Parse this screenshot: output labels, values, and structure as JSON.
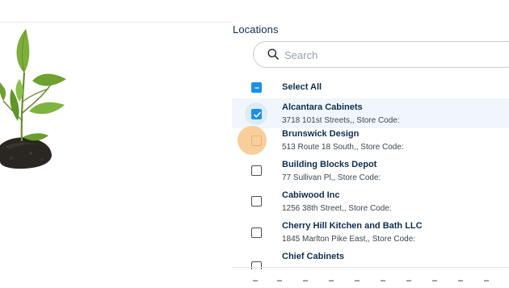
{
  "panel": {
    "title": "Locations"
  },
  "search": {
    "placeholder": "Search",
    "value": ""
  },
  "select_all": {
    "label": "Select All",
    "state": "partial"
  },
  "locations": [
    {
      "name": "Alcantara Cabinets",
      "address": "3718 101st Streets,, Store Code:",
      "checked": true
    },
    {
      "name": "Brunswick Design",
      "address": "513 Route 18 South,, Store Code:",
      "checked": false,
      "hovered": true
    },
    {
      "name": "Building Blocks Depot",
      "address": "77 Sullivan Pl,, Store Code:",
      "checked": false
    },
    {
      "name": "Cabiwood Inc",
      "address": "1256 38th Street,, Store Code:",
      "checked": false
    },
    {
      "name": "Cherry Hill Kitchen and Bath LLC",
      "address": "1845 Marlton Pike East,, Store Code:",
      "checked": false
    },
    {
      "name": "Chief Cabinets",
      "address": "",
      "checked": false
    }
  ],
  "colors": {
    "accent": "#1e8fe6",
    "hover_halo": "#f7c98f",
    "selected_row": "#f0f6fb",
    "title_text": "#0f2f4f"
  },
  "icons": {
    "search": "search-icon",
    "check": "checkmark-icon",
    "partial": "minus-icon",
    "plant": "plant-illustration"
  }
}
